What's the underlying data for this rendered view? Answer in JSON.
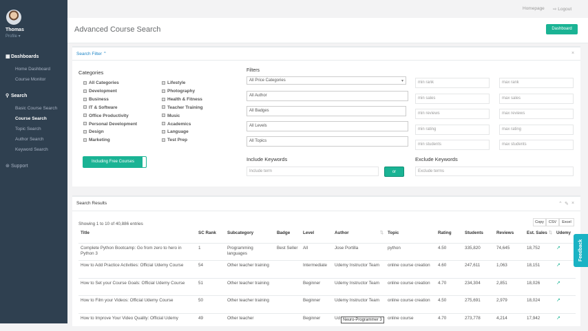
{
  "sidebar": {
    "user_name": "Thomas",
    "user_profile": "Profile ▾",
    "dashboards_header": "Dashboards",
    "dashboard_items": [
      "Home Dashboard",
      "Course Monitor"
    ],
    "search_header": "Search",
    "search_items": [
      "Basic Course Search",
      "Course Search",
      "Topic Search",
      "Author Search",
      "Keyword Search"
    ],
    "active_item": "Course Search",
    "support": "Support"
  },
  "topbar": {
    "homepage": "Homepage",
    "logout": "Logout"
  },
  "header": {
    "title": "Advanced Course Search",
    "dashboard_button": "Dashboard"
  },
  "filter_panel": {
    "title": "Search Filter",
    "categories_title": "Categories",
    "categories_col1": [
      "All Categories",
      "Development",
      "Business",
      "IT & Software",
      "Office Productivity",
      "Personal Development",
      "Design",
      "Marketing"
    ],
    "categories_col2": [
      "Lifestyle",
      "Photography",
      "Health & Fitness",
      "Teacher Training",
      "Music",
      "Academics",
      "Language",
      "Test Prep"
    ],
    "free_toggle": "Including Free Courses",
    "filters_title": "Filters",
    "price_select": "All Price Categories",
    "author": "All Author",
    "badges": "All Badges",
    "levels": "All Levels",
    "topics": "All Topics",
    "range_placeholders": [
      [
        "min rank",
        "max rank"
      ],
      [
        "min sales",
        "max sales"
      ],
      [
        "min reviews",
        "max reviews"
      ],
      [
        "min rating",
        "max rating"
      ],
      [
        "min students",
        "max students"
      ]
    ],
    "include_title": "Include Keywords",
    "include_placeholder": "Include term",
    "or_button": "or",
    "exclude_title": "Exclude Keywords",
    "exclude_placeholder": "Exclude terms"
  },
  "results_panel": {
    "title": "Search Results",
    "showing": "Showing 1 to 10 of 40,886 entries",
    "export_buttons": [
      "Copy",
      "CSV",
      "Excel"
    ],
    "columns": [
      "Title",
      "SC Rank",
      "Subcategory",
      "Badge",
      "Level",
      "Author",
      "Topic",
      "Rating",
      "Students",
      "Reviews",
      "Est. Sales",
      "Udemy"
    ],
    "rows": [
      [
        "Complete Python Bootcamp: Go from zero to hero in Python 3",
        "1",
        "Programming languages",
        "Best Seller",
        "All",
        "Jose Portilla",
        "python",
        "4.50",
        "335,820",
        "74,645",
        "18,752"
      ],
      [
        "How to Add Practice Activities: Official Udemy Course",
        "54",
        "Other teacher training",
        "",
        "Intermediate",
        "Udemy Instructor Team",
        "online course creation",
        "4.60",
        "247,611",
        "1,063",
        "18,151"
      ],
      [
        "How to Set your Course Goals: Official Udemy Course",
        "51",
        "Other teacher training",
        "",
        "Beginner",
        "Udemy Instructor Team",
        "online course creation",
        "4.70",
        "234,304",
        "2,851",
        "18,026"
      ],
      [
        "How to Film your Videos: Official Udemy Course",
        "50",
        "Other teacher training",
        "",
        "Beginner",
        "Udemy Instructor Team",
        "online course creation",
        "4.50",
        "275,691",
        "2,979",
        "18,024"
      ],
      [
        "How to Improve Your Video Quality: Official Udemy",
        "49",
        "Other teacher",
        "",
        "Beginner",
        "Ud",
        "online course",
        "4.70",
        "273,778",
        "4,214",
        "17,942"
      ]
    ],
    "tooltip": "Neuro-Programmer 3"
  },
  "feedback": "Feedback"
}
